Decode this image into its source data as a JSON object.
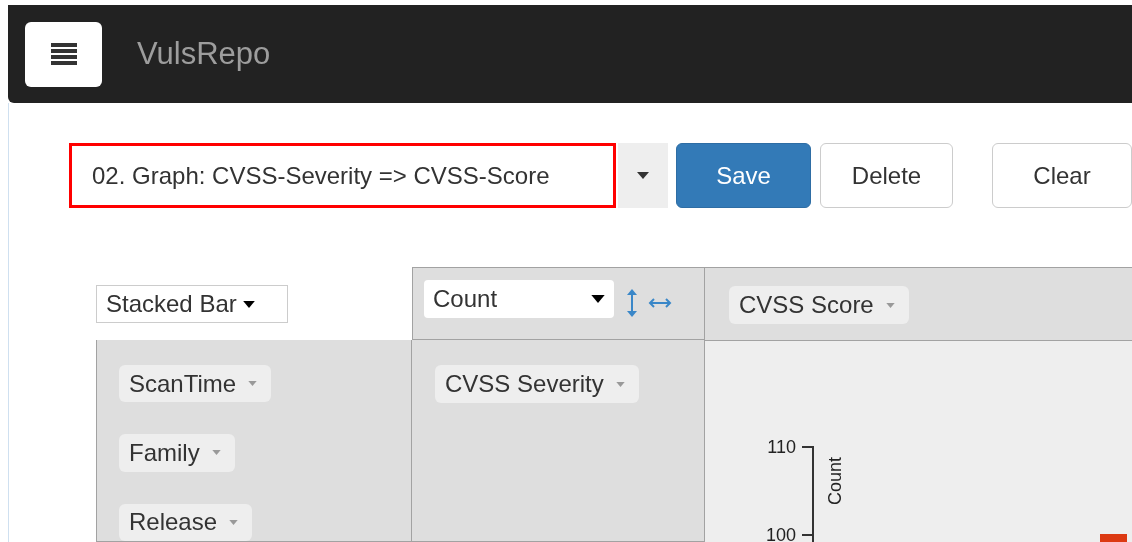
{
  "navbar": {
    "title": "VulsRepo"
  },
  "toolbar": {
    "preset": {
      "value": "02. Graph: CVSS-Severity => CVSS-Score",
      "highlighted": true
    },
    "buttons": [
      {
        "label": "Save",
        "kind": "primary"
      },
      {
        "label": "Delete",
        "kind": "default"
      },
      {
        "label": "Clear",
        "kind": "default"
      }
    ]
  },
  "pivot": {
    "renderer": "Stacked Bar",
    "aggregator": "Count",
    "column_attributes": [
      "CVSS Score"
    ],
    "row_attributes": [
      "CVSS Severity"
    ],
    "unused_attributes": [
      "ScanTime",
      "Family",
      "Release"
    ],
    "chart": {
      "y_axis_title": "Count",
      "y_tick_labels": [
        "110",
        "100"
      ]
    }
  }
}
